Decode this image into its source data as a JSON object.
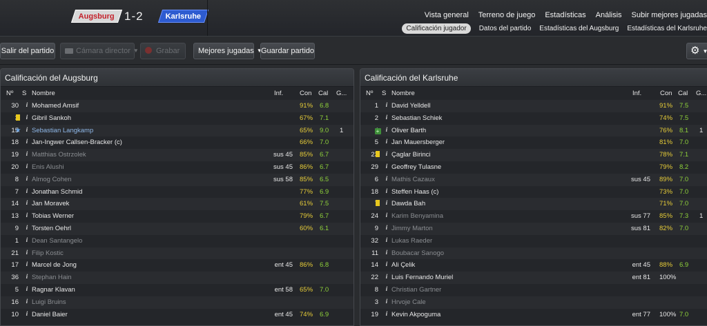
{
  "match": {
    "home": "Augsburg",
    "away": "Karlsruhe",
    "score": "1-2"
  },
  "nav_main": [
    "Vista general",
    "Terreno de juego",
    "Estadísticas",
    "Análisis",
    "Subir mejores jugadas"
  ],
  "nav_sub": [
    "Calificación jugador",
    "Datos del partido",
    "Estadísticas del Augsburg",
    "Estadísticas del Karlsruhe"
  ],
  "toolbar": {
    "exit": "Salir del partido",
    "camera": "Cámara director",
    "record": "Grabar",
    "highlights": "Mejores jugadas",
    "save": "Guardar partido"
  },
  "columns": {
    "no": "Nº",
    "s": "S",
    "name": "Nombre",
    "inf": "Inf.",
    "con": "Con",
    "cal": "Cal",
    "g": "G..."
  },
  "home_panel": {
    "title": "Calificación del Augsburg",
    "rows": [
      {
        "no": "30",
        "s": "",
        "name": "Mohamed Amsif",
        "inf": "",
        "con": "91%",
        "cal": "6.8",
        "g": "",
        "dim": false
      },
      {
        "no": "3",
        "s": "yellow",
        "name": "Gibril Sankoh",
        "inf": "",
        "con": "67%",
        "cal": "7.1",
        "g": "",
        "dim": false
      },
      {
        "no": "15",
        "s": "star",
        "name": "Sebastian Langkamp",
        "inf": "",
        "con": "65%",
        "cal": "9.0",
        "g": "1",
        "dim": false
      },
      {
        "no": "18",
        "s": "",
        "name": "Jan-Ingwer Callsen-Bracker (c)",
        "inf": "",
        "con": "66%",
        "cal": "7.0",
        "g": "",
        "dim": false
      },
      {
        "no": "19",
        "s": "",
        "name": "Matthias Ostrzolek",
        "inf": "sus 45",
        "con": "85%",
        "cal": "6.7",
        "g": "",
        "dim": true
      },
      {
        "no": "20",
        "s": "",
        "name": "Enis Alushi",
        "inf": "sus 45",
        "con": "86%",
        "cal": "6.7",
        "g": "",
        "dim": true
      },
      {
        "no": "8",
        "s": "",
        "name": "Almog Cohen",
        "inf": "sus 58",
        "con": "85%",
        "cal": "6.5",
        "g": "",
        "dim": true
      },
      {
        "no": "7",
        "s": "",
        "name": "Jonathan Schmid",
        "inf": "",
        "con": "77%",
        "cal": "6.9",
        "g": "",
        "dim": false
      },
      {
        "no": "14",
        "s": "",
        "name": "Jan Moravek",
        "inf": "",
        "con": "61%",
        "cal": "7.5",
        "g": "",
        "dim": false
      },
      {
        "no": "13",
        "s": "",
        "name": "Tobias Werner",
        "inf": "",
        "con": "79%",
        "cal": "6.7",
        "g": "",
        "dim": false
      },
      {
        "no": "9",
        "s": "",
        "name": "Torsten Oehrl",
        "inf": "",
        "con": "60%",
        "cal": "6.1",
        "g": "",
        "dim": false
      },
      {
        "no": "1",
        "s": "",
        "name": "Dean Santangelo",
        "inf": "",
        "con": "",
        "cal": "",
        "g": "",
        "dim": true
      },
      {
        "no": "21",
        "s": "",
        "name": "Filip Kostic",
        "inf": "",
        "con": "",
        "cal": "",
        "g": "",
        "dim": true
      },
      {
        "no": "17",
        "s": "",
        "name": "Marcel de Jong",
        "inf": "ent 45",
        "con": "86%",
        "cal": "6.8",
        "g": "",
        "dim": false
      },
      {
        "no": "36",
        "s": "",
        "name": "Stephan Hain",
        "inf": "",
        "con": "",
        "cal": "",
        "g": "",
        "dim": true
      },
      {
        "no": "5",
        "s": "",
        "name": "Ragnar Klavan",
        "inf": "ent 58",
        "con": "65%",
        "cal": "7.0",
        "g": "",
        "dim": false
      },
      {
        "no": "16",
        "s": "",
        "name": "Luigi Bruins",
        "inf": "",
        "con": "",
        "cal": "",
        "g": "",
        "dim": true
      },
      {
        "no": "10",
        "s": "",
        "name": "Daniel Baier",
        "inf": "ent 45",
        "con": "74%",
        "cal": "6.9",
        "g": "",
        "dim": false
      }
    ]
  },
  "away_panel": {
    "title": "Calificación del Karlsruhe",
    "rows": [
      {
        "no": "1",
        "s": "",
        "name": "David Yelldell",
        "inf": "",
        "con": "91%",
        "cal": "7.5",
        "g": "",
        "dim": false
      },
      {
        "no": "2",
        "s": "",
        "name": "Sebastian Schiek",
        "inf": "",
        "con": "74%",
        "cal": "7.5",
        "g": "",
        "dim": false
      },
      {
        "no": "4",
        "s": "plus",
        "name": "Oliver Barth",
        "inf": "",
        "con": "76%",
        "cal": "8.1",
        "g": "1",
        "dim": false
      },
      {
        "no": "5",
        "s": "",
        "name": "Jan Mauersberger",
        "inf": "",
        "con": "81%",
        "cal": "7.0",
        "g": "",
        "dim": false
      },
      {
        "no": "23",
        "s": "yellow",
        "name": "Çaglar Birinci",
        "inf": "",
        "con": "78%",
        "cal": "7.1",
        "g": "",
        "dim": false
      },
      {
        "no": "29",
        "s": "",
        "name": "Geoffrey Tulasne",
        "inf": "",
        "con": "79%",
        "cal": "8.2",
        "g": "",
        "dim": false
      },
      {
        "no": "6",
        "s": "",
        "name": "Mathis Cazaux",
        "inf": "sus 45",
        "con": "89%",
        "cal": "7.0",
        "g": "",
        "dim": true
      },
      {
        "no": "18",
        "s": "",
        "name": "Steffen Haas (c)",
        "inf": "",
        "con": "73%",
        "cal": "7.0",
        "g": "",
        "dim": false
      },
      {
        "no": "7",
        "s": "yellow",
        "name": "Dawda Bah",
        "inf": "",
        "con": "71%",
        "cal": "7.0",
        "g": "",
        "dim": false
      },
      {
        "no": "24",
        "s": "",
        "name": "Karim Benyamina",
        "inf": "sus 77",
        "con": "85%",
        "cal": "7.3",
        "g": "1",
        "dim": true
      },
      {
        "no": "9",
        "s": "",
        "name": "Jimmy Marton",
        "inf": "sus 81",
        "con": "82%",
        "cal": "7.0",
        "g": "",
        "dim": true
      },
      {
        "no": "32",
        "s": "",
        "name": "Lukas Raeder",
        "inf": "",
        "con": "",
        "cal": "",
        "g": "",
        "dim": true
      },
      {
        "no": "11",
        "s": "",
        "name": "Boubacar Sanogo",
        "inf": "",
        "con": "",
        "cal": "",
        "g": "",
        "dim": true
      },
      {
        "no": "14",
        "s": "",
        "name": "Ali Çelik",
        "inf": "ent 45",
        "con": "88%",
        "cal": "6.9",
        "g": "",
        "dim": false
      },
      {
        "no": "22",
        "s": "",
        "name": "Luis Fernando Muriel",
        "inf": "ent 81",
        "con": "100%",
        "cal": "",
        "g": "",
        "dim": false
      },
      {
        "no": "8",
        "s": "",
        "name": "Christian Gartner",
        "inf": "",
        "con": "",
        "cal": "",
        "g": "",
        "dim": true
      },
      {
        "no": "3",
        "s": "",
        "name": "Hrvoje Cale",
        "inf": "",
        "con": "",
        "cal": "",
        "g": "",
        "dim": true
      },
      {
        "no": "19",
        "s": "",
        "name": "Kevin Akpoguma",
        "inf": "ent 77",
        "con": "100%",
        "cal": "7.0",
        "g": "",
        "dim": false
      }
    ]
  },
  "colors": {
    "con": "#e6cc38",
    "cal": "#8fd23a",
    "yellow_card": "#e8c81e",
    "home_badge_text": "#c4202a",
    "away_badge_bg": "#2d5bd0"
  }
}
